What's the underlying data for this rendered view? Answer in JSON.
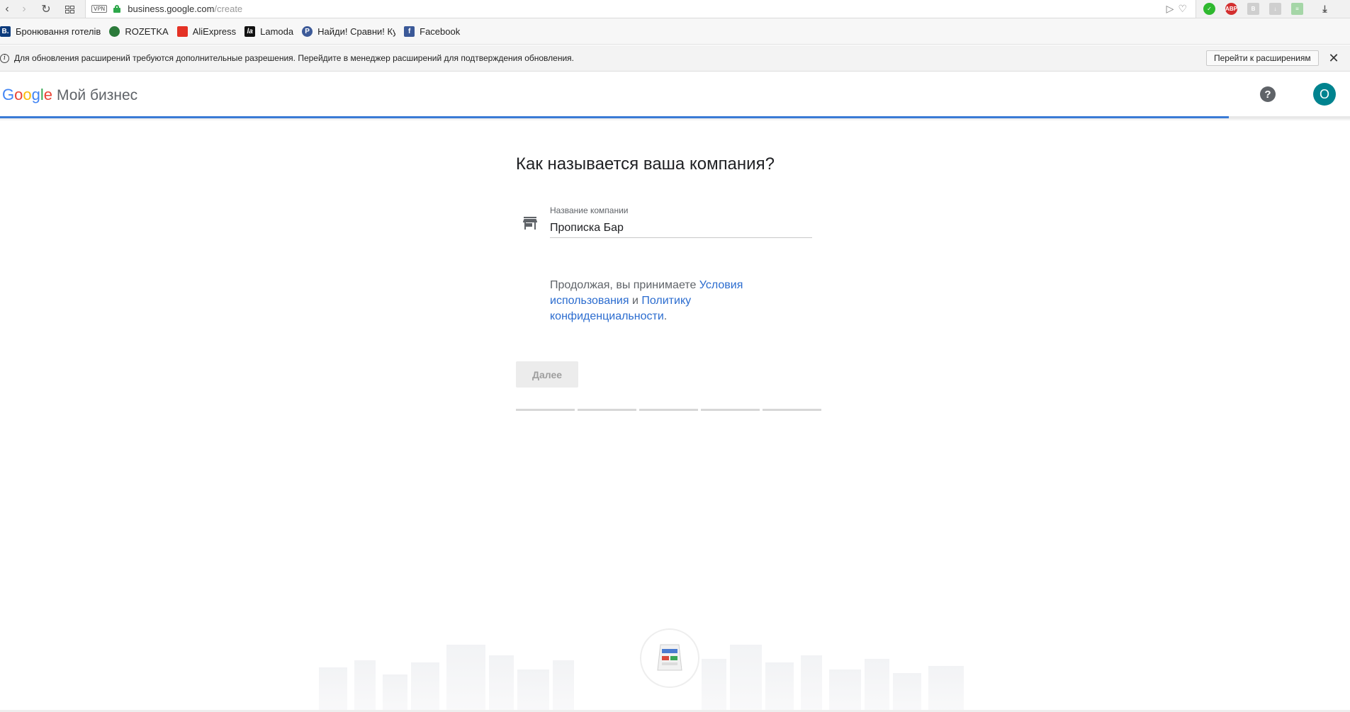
{
  "browser": {
    "vpn_label": "VPN",
    "url_domain": "business.google.com",
    "url_path": "/create",
    "bookmarks": [
      {
        "label": "Бронювання готелів",
        "icon": "booking-icon",
        "color": "#0c3b7c",
        "letter": "B."
      },
      {
        "label": "ROZETKA",
        "icon": "rozetka-icon",
        "color": "#2b7a3a",
        "letter": ""
      },
      {
        "label": "AliExpress",
        "icon": "aliexpress-icon",
        "color": "#e43225",
        "letter": ""
      },
      {
        "label": "Lamoda",
        "icon": "lamoda-icon",
        "color": "#111111",
        "letter": "la"
      },
      {
        "label": "Найди! Сравни! Куп",
        "icon": "price-icon",
        "color": "#3d5a98",
        "letter": "P"
      },
      {
        "label": "Facebook",
        "icon": "facebook-icon",
        "color": "#3b5998",
        "letter": "f"
      }
    ]
  },
  "notice": {
    "text": "Для обновления расширений требуются дополнительные разрешения. Перейдите в менеджер расширений для подтверждения обновления.",
    "button_label": "Перейти к расширениям",
    "close_symbol": "✕"
  },
  "header": {
    "logo_letters": [
      "G",
      "o",
      "o",
      "g",
      "l",
      "e"
    ],
    "product_name": "Мой бизнес",
    "help_symbol": "?",
    "avatar_letter": "O",
    "progress_fraction": 0.91
  },
  "form": {
    "heading": "Как называется ваша компания?",
    "field_label": "Название компании",
    "field_value": "Прописка Бар",
    "terms_prefix": "Продолжая, вы принимаете ",
    "terms_link": "Условия использования",
    "terms_mid": " и ",
    "privacy_link": "Политику конфиденциальности",
    "terms_suffix": ".",
    "next_label": "Далее",
    "step_count": 5,
    "current_step": 0
  },
  "colors": {
    "accent": "#3a7bd5",
    "link": "#2b6ccf",
    "avatar": "#00838f"
  }
}
